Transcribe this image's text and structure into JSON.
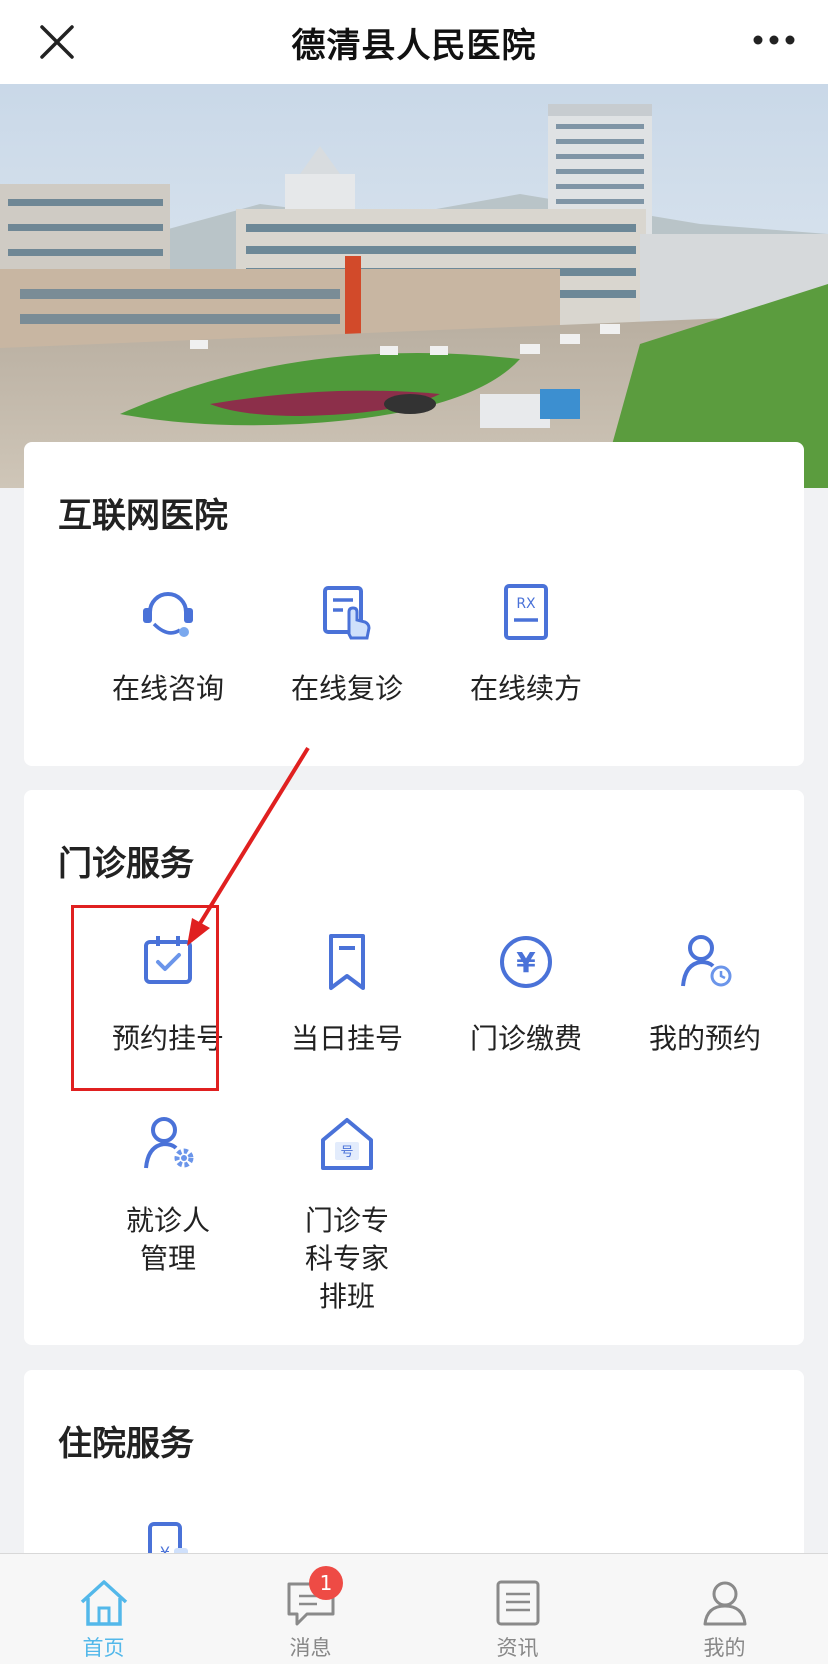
{
  "header": {
    "title": "德清县人民医院"
  },
  "internet_hospital": {
    "title": "互联网医院",
    "items": [
      {
        "label": "在线咨询",
        "icon": "headset-icon"
      },
      {
        "label": "在线复诊",
        "icon": "touch-document-icon"
      },
      {
        "label": "在线续方",
        "icon": "prescription-rx-icon"
      }
    ]
  },
  "outpatient": {
    "title": "门诊服务",
    "items": [
      {
        "label": "预约挂号",
        "icon": "calendar-check-icon"
      },
      {
        "label": "当日挂号",
        "icon": "bookmark-icon"
      },
      {
        "label": "门诊缴费",
        "icon": "yen-coin-icon"
      },
      {
        "label": "我的预约",
        "icon": "user-clock-icon"
      },
      {
        "label": "就诊人管理",
        "icon": "user-gear-icon"
      },
      {
        "label": "门诊专科专家排班",
        "icon": "house-number-icon"
      }
    ]
  },
  "inpatient": {
    "title": "住院服务"
  },
  "tabbar": {
    "items": [
      {
        "label": "首页",
        "icon": "home-icon",
        "active": true
      },
      {
        "label": "消息",
        "icon": "chat-icon",
        "badge": "1"
      },
      {
        "label": "资讯",
        "icon": "news-icon"
      },
      {
        "label": "我的",
        "icon": "profile-icon"
      }
    ]
  },
  "colors": {
    "accent": "#4a72d8",
    "tab_active": "#53b8ea",
    "badge": "#ee4b45",
    "highlight": "#e02020"
  }
}
